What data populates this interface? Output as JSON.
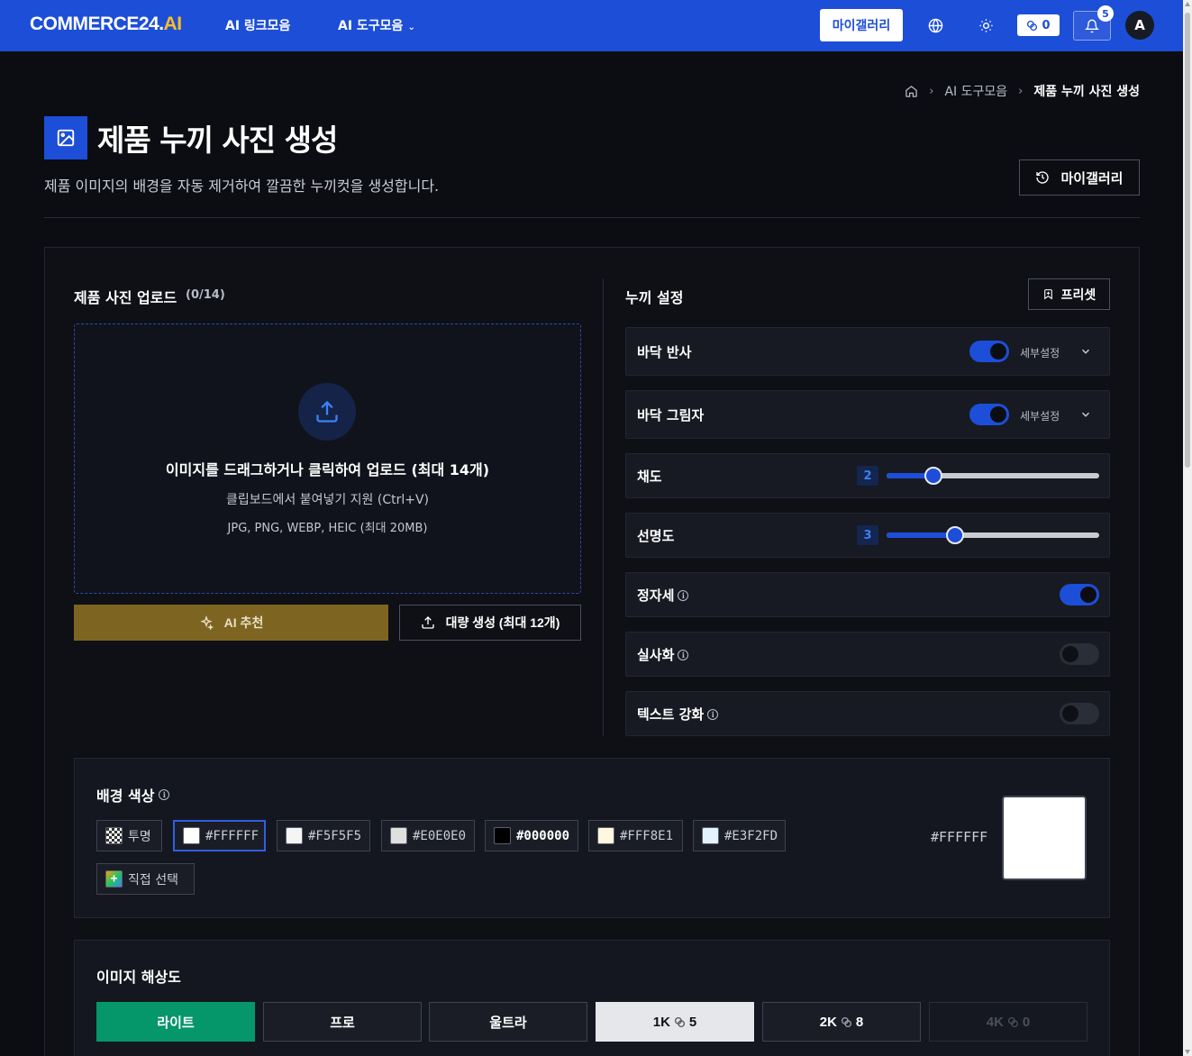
{
  "header": {
    "logo_main": "COMMERCE24.",
    "logo_ai": "AI",
    "nav": {
      "links_label": "AI 링크모음",
      "tools_label": "AI 도구모음"
    },
    "my_gallery": "마이갤러리",
    "credits": "0",
    "notification_count": "5",
    "avatar_initial": "A"
  },
  "breadcrumb": {
    "level1": "AI 도구모음",
    "current": "제품 누끼 사진 생성"
  },
  "page": {
    "title": "제품 누끼 사진 생성",
    "description": "제품 이미지의 배경을 자동 제거하여 깔끔한 누끼컷을 생성합니다.",
    "gallery_button": "마이갤러리"
  },
  "upload": {
    "title": "제품 사진 업로드",
    "count": "(0/14)",
    "drop_main": "이미지를 드래그하거나 클릭하여 업로드 (최대 14개)",
    "drop_sub": "클립보드에서 붙여넣기 지원 (Ctrl+V)",
    "drop_formats": "JPG, PNG, WEBP, HEIC (최대 20MB)",
    "ai_button": "AI 추천",
    "bulk_button": "대량 생성 (최대 12개)"
  },
  "settings": {
    "title": "누끼 설정",
    "preset_button": "프리셋",
    "detail_label": "세부설정",
    "floor_reflection": {
      "label": "바닥 반사",
      "enabled": true
    },
    "floor_shadow": {
      "label": "바닥 그림자",
      "enabled": true
    },
    "saturation": {
      "label": "채도",
      "value": "2",
      "fraction": 0.22
    },
    "sharpness": {
      "label": "선명도",
      "value": "3",
      "fraction": 0.32
    },
    "front_pose": {
      "label": "정자세",
      "enabled": true
    },
    "photoreal": {
      "label": "실사화",
      "enabled": false
    },
    "text_enhance": {
      "label": "텍스트 강화",
      "enabled": false
    }
  },
  "background": {
    "title": "배경 색상",
    "transparent_label": "투명",
    "custom_label": "직접 선택",
    "selected_hex": "#FFFFFF",
    "swatches": [
      {
        "hex": "#FFFFFF",
        "color": "#FFFFFF"
      },
      {
        "hex": "#F5F5F5",
        "color": "#F5F5F5"
      },
      {
        "hex": "#E0E0E0",
        "color": "#E0E0E0"
      },
      {
        "hex": "#000000",
        "color": "#000000"
      },
      {
        "hex": "#FFF8E1",
        "color": "#FFF8E1"
      },
      {
        "hex": "#E3F2FD",
        "color": "#E3F2FD"
      }
    ]
  },
  "resolution": {
    "title": "이미지 해상도",
    "tiers": [
      "라이트",
      "프로",
      "울트라"
    ],
    "sizes": [
      {
        "label": "1K",
        "cost": "5"
      },
      {
        "label": "2K",
        "cost": "8"
      },
      {
        "label": "4K",
        "cost": "0"
      }
    ]
  }
}
